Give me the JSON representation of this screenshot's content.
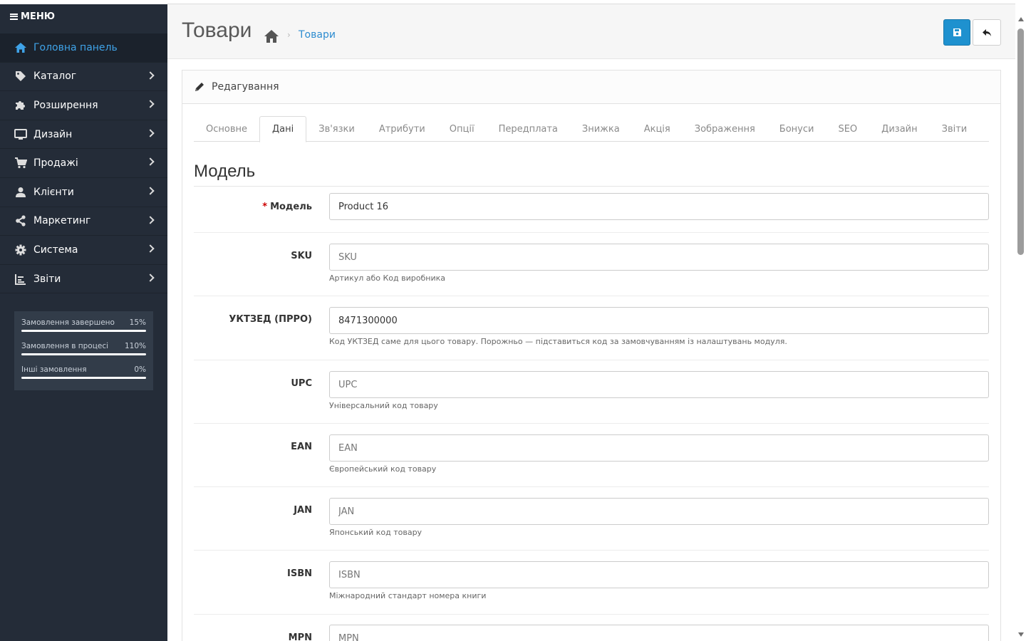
{
  "sidebar": {
    "menu_label": "МЕНЮ",
    "items": [
      {
        "label": "Головна панель",
        "icon": "home-icon"
      },
      {
        "label": "Каталог",
        "icon": "tag-icon"
      },
      {
        "label": "Розширення",
        "icon": "puzzle-icon"
      },
      {
        "label": "Дизайн",
        "icon": "monitor-icon"
      },
      {
        "label": "Продажі",
        "icon": "cart-icon"
      },
      {
        "label": "Клієнти",
        "icon": "user-icon"
      },
      {
        "label": "Маркетинг",
        "icon": "share-icon"
      },
      {
        "label": "Система",
        "icon": "gear-icon"
      },
      {
        "label": "Звіти",
        "icon": "bar-chart-icon"
      }
    ],
    "stats": [
      {
        "label": "Замовлення завершено",
        "value": "15%"
      },
      {
        "label": "Замовлення в процесі",
        "value": "110%"
      },
      {
        "label": "Інші замовлення",
        "value": "0%"
      }
    ]
  },
  "header": {
    "title": "Товари",
    "breadcrumb": "Товари"
  },
  "panel": {
    "title": "Редагування",
    "tabs": [
      "Основне",
      "Дані",
      "Зв'язки",
      "Атрибути",
      "Опції",
      "Передплата",
      "Знижка",
      "Акція",
      "Зображення",
      "Бонуси",
      "SEO",
      "Дизайн",
      "Звіти"
    ],
    "active_tab": "Дані",
    "section_title": "Модель",
    "fields": {
      "model": {
        "label": "Модель",
        "value": "Product 16"
      },
      "sku": {
        "label": "SKU",
        "placeholder": "SKU",
        "help": "Артикул або Код виробника"
      },
      "uktzed": {
        "label": "УКТЗЕД (ПРРО)",
        "value": "8471300000",
        "help": "Код УКТЗЕД саме для цього товару. Порожньо — підставиться код за замовчуванням із налаштувань модуля."
      },
      "upc": {
        "label": "UPC",
        "placeholder": "UPC",
        "help": "Універсальний код товару"
      },
      "ean": {
        "label": "EAN",
        "placeholder": "EAN",
        "help": "Європейський код товару"
      },
      "jan": {
        "label": "JAN",
        "placeholder": "JAN",
        "help": "Японський код товару"
      },
      "isbn": {
        "label": "ISBN",
        "placeholder": "ISBN",
        "help": "Міжнародний стандарт номера книги"
      },
      "mpn": {
        "label": "MPN",
        "placeholder": "MPN"
      }
    }
  },
  "colors": {
    "sidebar_bg": "#242c38",
    "accent": "#1e91cf",
    "active_link": "#3fa3e8"
  }
}
